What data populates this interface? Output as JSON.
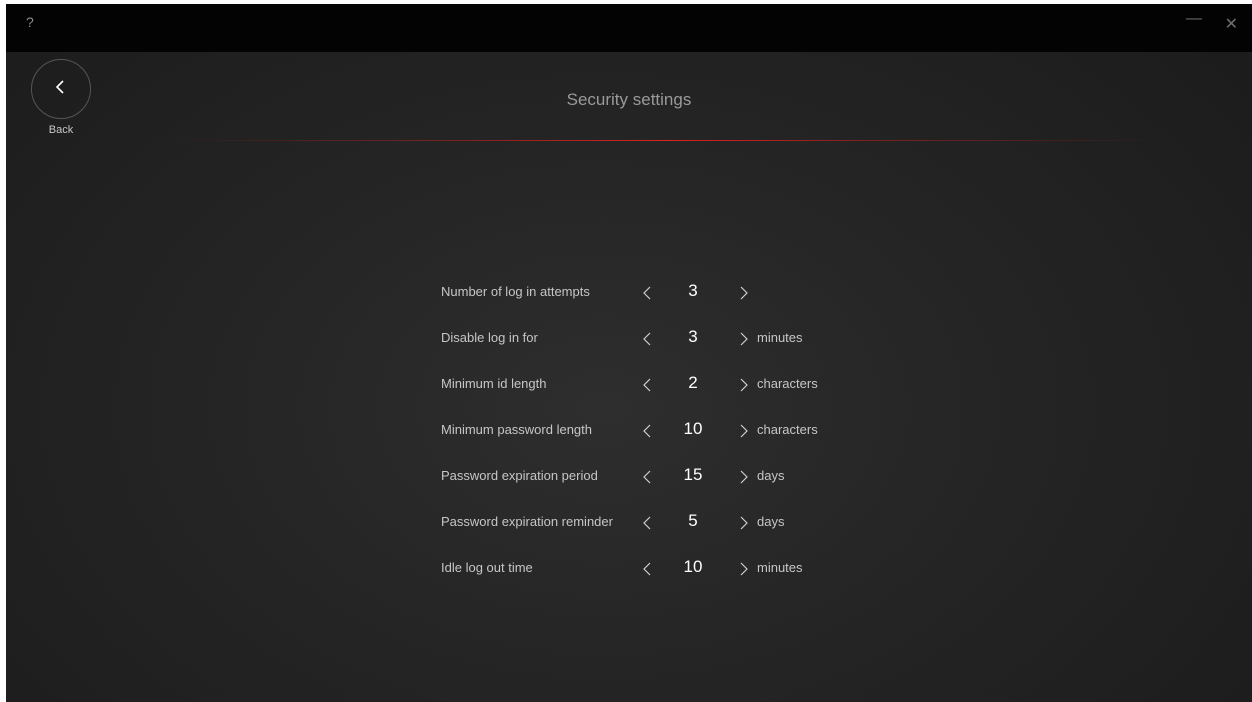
{
  "titlebar": {
    "help_label": "?",
    "minimize_label": "—",
    "close_label": "✕"
  },
  "back": {
    "label": "Back",
    "icon": "chevron-left-icon"
  },
  "page": {
    "title": "Security settings",
    "accent_color": "#e02020"
  },
  "settings": [
    {
      "label": "Number of log in attempts",
      "value": "3",
      "unit": ""
    },
    {
      "label": "Disable log in for",
      "value": "3",
      "unit": "minutes"
    },
    {
      "label": "Minimum id length",
      "value": "2",
      "unit": "characters"
    },
    {
      "label": "Minimum password length",
      "value": "10",
      "unit": "characters"
    },
    {
      "label": "Password expiration period",
      "value": "15",
      "unit": "days"
    },
    {
      "label": "Password expiration reminder",
      "value": "5",
      "unit": "days"
    },
    {
      "label": "Idle log out time",
      "value": "10",
      "unit": "minutes"
    }
  ]
}
